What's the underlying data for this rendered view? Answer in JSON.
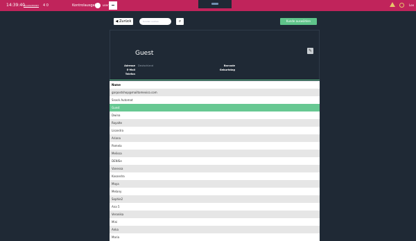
{
  "topbar": {
    "time": "14:39:40",
    "logo_text": "BLAUSCHMIDT",
    "count": "4 0",
    "kasse_label": "Kontrolausgabe",
    "user_label": "user",
    "accent": "#c0245b"
  },
  "toolbar": {
    "back_label": "◀ Zurück",
    "search_placeholder": "Kunden suchen",
    "select_label": "Kunde auswählen"
  },
  "customer": {
    "name": "Guest",
    "address_label": "Adresse",
    "address_value": "Deutschland",
    "email_label": "E-Mail",
    "phone_label": "Telefon",
    "barcode_label": "Barcode",
    "birthday_label": "Geburtstag"
  },
  "table": {
    "header": "Name",
    "rows": [
      "garpostshop@mailtomexico.com",
      "Snack Automat",
      "Guest",
      "Dwina",
      "Royalte",
      "Lisandra",
      "Ariana",
      "Pamela",
      "Melissa",
      "DENISe",
      "Vanessa",
      "Kasandra",
      "Maya",
      "Melany",
      "Sophie2",
      "Ana 5",
      "Veronika",
      "Mini",
      "Anka",
      "Maria"
    ],
    "selected_index": 2
  }
}
